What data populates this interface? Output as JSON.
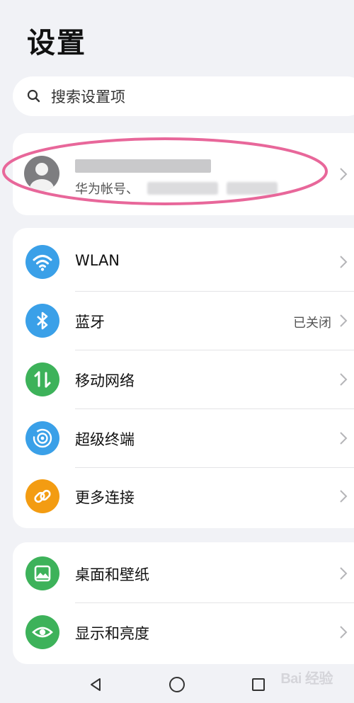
{
  "header": {
    "title": "设置"
  },
  "search": {
    "placeholder": "搜索设置项"
  },
  "account": {
    "subtitle": "华为帐号、"
  },
  "connectivity": [
    {
      "label": "WLAN",
      "value": "",
      "icon": "wifi-icon",
      "color": "#3aa0e8"
    },
    {
      "label": "蓝牙",
      "value": "已关闭",
      "icon": "bluetooth-icon",
      "color": "#3aa0e8"
    },
    {
      "label": "移动网络",
      "value": "",
      "icon": "mobile-data-icon",
      "color": "#3db25a"
    },
    {
      "label": "超级终端",
      "value": "",
      "icon": "super-device-icon",
      "color": "#3aa0e8"
    },
    {
      "label": "更多连接",
      "value": "",
      "icon": "link-icon",
      "color": "#f39c12"
    }
  ],
  "personalization": [
    {
      "label": "桌面和壁纸",
      "value": "",
      "icon": "wallpaper-icon",
      "color": "#3db25a"
    },
    {
      "label": "显示和亮度",
      "value": "",
      "icon": "eye-icon",
      "color": "#3db25a"
    }
  ],
  "annotation": {
    "color": "#e8679a"
  },
  "watermark": {
    "text": "Bai 经验"
  }
}
